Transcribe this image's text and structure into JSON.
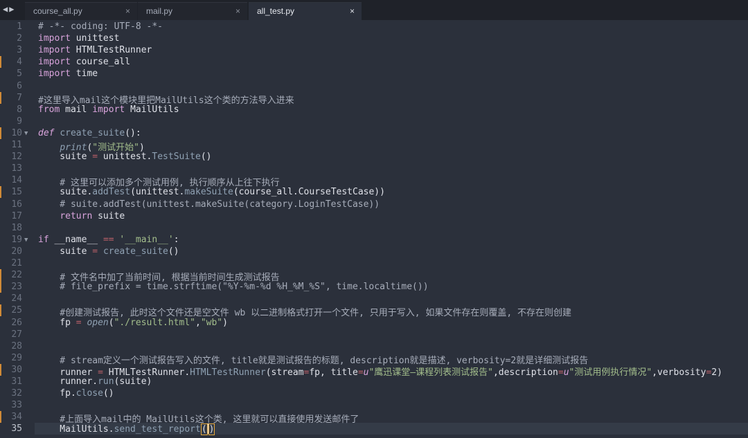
{
  "tabs": [
    {
      "label": "course_all.py",
      "close": "×"
    },
    {
      "label": "mail.py",
      "close": "×"
    },
    {
      "label": "all_test.py",
      "close": "×",
      "active": true
    }
  ],
  "nav": {
    "back": "◀",
    "forward": "▶"
  },
  "editor": {
    "active_line": 35,
    "lines": [
      [
        {
          "t": "# -*- coding: UTF-8 -*-",
          "c": "cm"
        }
      ],
      [
        {
          "t": "import",
          "c": "kw"
        },
        {
          "t": " unittest",
          "c": "pl"
        }
      ],
      [
        {
          "t": "import",
          "c": "kw"
        },
        {
          "t": " HTMLTestRunner",
          "c": "pl"
        }
      ],
      [
        {
          "t": "import",
          "c": "kw"
        },
        {
          "t": " course_all",
          "c": "pl"
        }
      ],
      [
        {
          "t": "import",
          "c": "kw"
        },
        {
          "t": " time",
          "c": "pl"
        }
      ],
      [],
      [
        {
          "t": "#这里导入mail这个模块里把MailUtils这个类的方法导入进来",
          "c": "cm"
        }
      ],
      [
        {
          "t": "from",
          "c": "kw"
        },
        {
          "t": " mail ",
          "c": "pl"
        },
        {
          "t": "import",
          "c": "kw"
        },
        {
          "t": " MailUtils",
          "c": "pl"
        }
      ],
      [],
      [
        {
          "t": "def",
          "c": "kw it"
        },
        {
          "t": " ",
          "c": "pl"
        },
        {
          "t": "create_suite",
          "c": "fn"
        },
        {
          "t": "():",
          "c": "pl"
        }
      ],
      [
        {
          "t": "    ",
          "c": "pl"
        },
        {
          "t": "print",
          "c": "fn it"
        },
        {
          "t": "(",
          "c": "pl"
        },
        {
          "t": "\"测试开始\"",
          "c": "str"
        },
        {
          "t": ")",
          "c": "pl"
        }
      ],
      [
        {
          "t": "    suite ",
          "c": "pl"
        },
        {
          "t": "=",
          "c": "op"
        },
        {
          "t": " unittest.",
          "c": "pl"
        },
        {
          "t": "TestSuite",
          "c": "fn"
        },
        {
          "t": "()",
          "c": "pl"
        }
      ],
      [],
      [
        {
          "t": "    # 这里可以添加多个测试用例, 执行顺序从上往下执行",
          "c": "cm"
        }
      ],
      [
        {
          "t": "    suite.",
          "c": "pl"
        },
        {
          "t": "addTest",
          "c": "fn"
        },
        {
          "t": "(unittest.",
          "c": "pl"
        },
        {
          "t": "makeSuite",
          "c": "fn"
        },
        {
          "t": "(course_all.CourseTestCase))",
          "c": "pl"
        }
      ],
      [
        {
          "t": "    # suite.addTest(unittest.makeSuite(category.LoginTestCase))",
          "c": "cm"
        }
      ],
      [
        {
          "t": "    ",
          "c": "pl"
        },
        {
          "t": "return",
          "c": "kw"
        },
        {
          "t": " suite",
          "c": "pl"
        }
      ],
      [],
      [
        {
          "t": "if",
          "c": "kw"
        },
        {
          "t": " __name__ ",
          "c": "pl"
        },
        {
          "t": "==",
          "c": "op"
        },
        {
          "t": " ",
          "c": "pl"
        },
        {
          "t": "'__main__'",
          "c": "str"
        },
        {
          "t": ":",
          "c": "pl"
        }
      ],
      [
        {
          "t": "    suite ",
          "c": "pl"
        },
        {
          "t": "=",
          "c": "op"
        },
        {
          "t": " ",
          "c": "pl"
        },
        {
          "t": "create_suite",
          "c": "fn"
        },
        {
          "t": "()",
          "c": "pl"
        }
      ],
      [],
      [
        {
          "t": "    # 文件名中加了当前时间, 根据当前时间生成测试报告",
          "c": "cm"
        }
      ],
      [
        {
          "t": "    # file_prefix = time.strftime(\"%Y-%m-%d %H_%M_%S\", time.localtime())",
          "c": "cm"
        }
      ],
      [],
      [
        {
          "t": "    #创建测试报告, 此时这个文件还是空文件 wb 以二进制格式打开一个文件, 只用于写入, 如果文件存在则覆盖, 不存在则创建",
          "c": "cm"
        }
      ],
      [
        {
          "t": "    fp ",
          "c": "pl"
        },
        {
          "t": "=",
          "c": "op"
        },
        {
          "t": " ",
          "c": "pl"
        },
        {
          "t": "open",
          "c": "fn it"
        },
        {
          "t": "(",
          "c": "pl"
        },
        {
          "t": "\"./result.html\"",
          "c": "str"
        },
        {
          "t": ",",
          "c": "pl"
        },
        {
          "t": "\"wb\"",
          "c": "str"
        },
        {
          "t": ")",
          "c": "pl"
        }
      ],
      [],
      [],
      [
        {
          "t": "    # stream定义一个测试报告写入的文件, title就是测试报告的标题, description就是描述, verbosity=2就是详细测试报告",
          "c": "cm"
        }
      ],
      [
        {
          "t": "    runner ",
          "c": "pl"
        },
        {
          "t": "=",
          "c": "op"
        },
        {
          "t": " HTMLTestRunner.",
          "c": "pl"
        },
        {
          "t": "HTMLTestRunner",
          "c": "fn"
        },
        {
          "t": "(stream",
          "c": "pl"
        },
        {
          "t": "=",
          "c": "op"
        },
        {
          "t": "fp, title",
          "c": "pl"
        },
        {
          "t": "=",
          "c": "op"
        },
        {
          "t": "u",
          "c": "kw it"
        },
        {
          "t": "\"鹰迅课堂—课程列表测试报告\"",
          "c": "str"
        },
        {
          "t": ",description",
          "c": "pl"
        },
        {
          "t": "=",
          "c": "op"
        },
        {
          "t": "u",
          "c": "kw it"
        },
        {
          "t": "\"测试用例执行情况\"",
          "c": "str"
        },
        {
          "t": ",verbosity",
          "c": "pl"
        },
        {
          "t": "=",
          "c": "op"
        },
        {
          "t": "2)",
          "c": "pl"
        }
      ],
      [
        {
          "t": "    runner.",
          "c": "pl"
        },
        {
          "t": "run",
          "c": "fn"
        },
        {
          "t": "(suite)",
          "c": "pl"
        }
      ],
      [
        {
          "t": "    fp.",
          "c": "pl"
        },
        {
          "t": "close",
          "c": "fn"
        },
        {
          "t": "()",
          "c": "pl"
        }
      ],
      [],
      [
        {
          "t": "    #上面导入mail中的 MailUtils这个类, 这里就可以直接使用发送邮件了",
          "c": "cm"
        }
      ],
      [
        {
          "t": "    MailUtils.",
          "c": "pl"
        },
        {
          "t": "send_test_report",
          "c": "fn"
        },
        {
          "t": "()",
          "c": "pl brk"
        }
      ]
    ],
    "fold_lines": [
      10,
      19
    ],
    "modified_lines": [
      4,
      7,
      10,
      15,
      22,
      23,
      25,
      30,
      34
    ]
  }
}
